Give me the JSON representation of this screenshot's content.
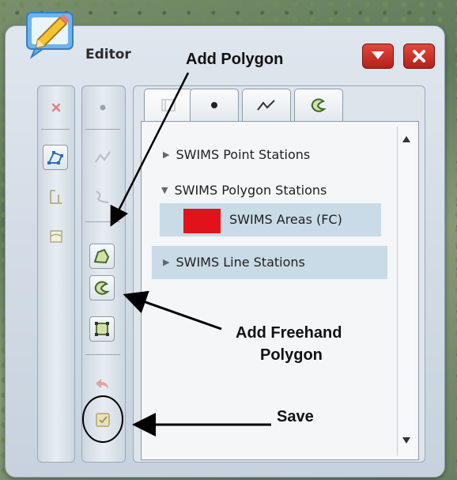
{
  "window": {
    "title": "Editor"
  },
  "tabs": [
    {
      "icon": "layer-list-icon"
    },
    {
      "icon": "point-icon"
    },
    {
      "icon": "line-icon"
    },
    {
      "icon": "freehand-polygon-icon"
    }
  ],
  "layers": [
    {
      "label": "SWIMS Point Stations",
      "expanded": false
    },
    {
      "label": "SWIMS Polygon Stations",
      "expanded": true,
      "children": [
        {
          "label": "SWIMS Areas (FC)",
          "swatch": "#e0121b"
        }
      ]
    },
    {
      "label": "SWIMS Line Stations",
      "expanded": false
    }
  ],
  "annotations": {
    "add_polygon": "Add Polygon",
    "add_freehand_line1": "Add Freehand",
    "add_freehand_line2": "Polygon",
    "save": "Save"
  },
  "colors": {
    "accent_red": "#d0281f",
    "selection": "#c9dbe7",
    "swatch": "#e0121b"
  }
}
